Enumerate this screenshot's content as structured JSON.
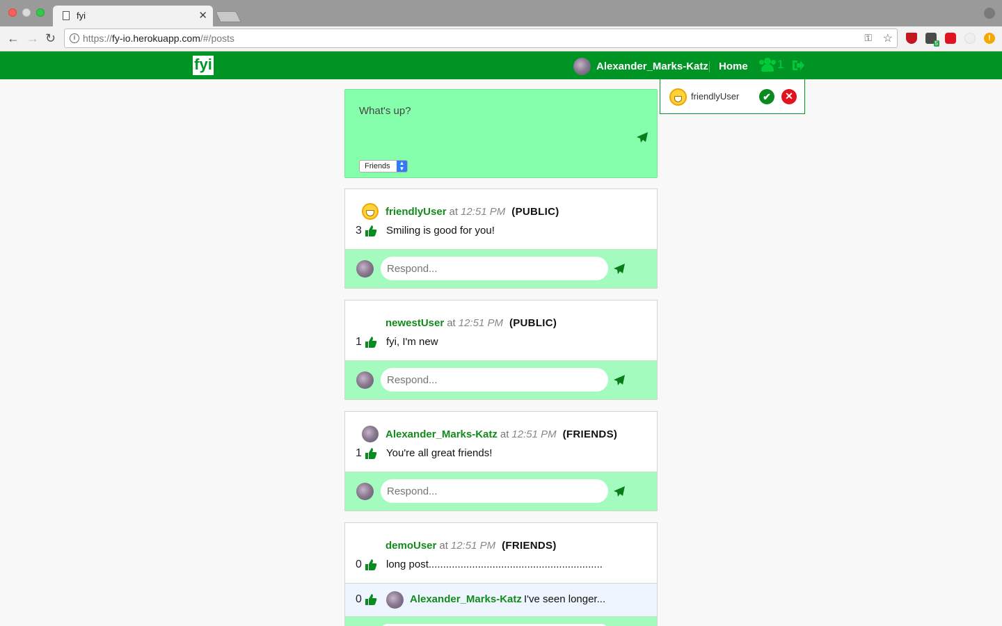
{
  "browser": {
    "tab_title": "fyi",
    "url_scheme": "https://",
    "url_host": "fy-io.herokuapp.com",
    "url_path": "/#/posts",
    "extension_badge": "5"
  },
  "header": {
    "logo": "fyi",
    "user_name": "Alexander_Marks-Katz",
    "home_label": "Home",
    "friend_request_count": "1"
  },
  "friend_request": {
    "name": "friendlyUser"
  },
  "composer": {
    "placeholder": "What's up?",
    "visibility": "Friends"
  },
  "posts": [
    {
      "author": "friendlyUser",
      "at": "at",
      "time": "12:51 PM",
      "visibility": "(PUBLIC)",
      "likes": "3",
      "body": "Smiling is good for you!",
      "avatar_icon": "grin-face-icon",
      "respond_placeholder": "Respond..."
    },
    {
      "author": "newestUser",
      "at": "at",
      "time": "12:51 PM",
      "visibility": "(PUBLIC)",
      "likes": "1",
      "body": "fyi, I'm new",
      "avatar_icon": "none",
      "respond_placeholder": "Respond..."
    },
    {
      "author": "Alexander_Marks-Katz",
      "at": "at",
      "time": "12:51 PM",
      "visibility": "(FRIENDS)",
      "likes": "1",
      "body": "You're all great friends!",
      "avatar_icon": "user-avatar",
      "respond_placeholder": "Respond..."
    },
    {
      "author": "demoUser",
      "at": "at",
      "time": "12:51 PM",
      "visibility": "(FRIENDS)",
      "likes": "0",
      "body": "long post............................................................",
      "avatar_icon": "none",
      "comments": [
        {
          "likes": "0",
          "author": "Alexander_Marks-Katz",
          "text": "I've seen longer..."
        }
      ]
    }
  ],
  "colors": {
    "brand_green": "#009425",
    "composer_bg": "#85ffab",
    "respond_bg": "#a3fbbe",
    "comment_bg": "#eef5ff"
  }
}
